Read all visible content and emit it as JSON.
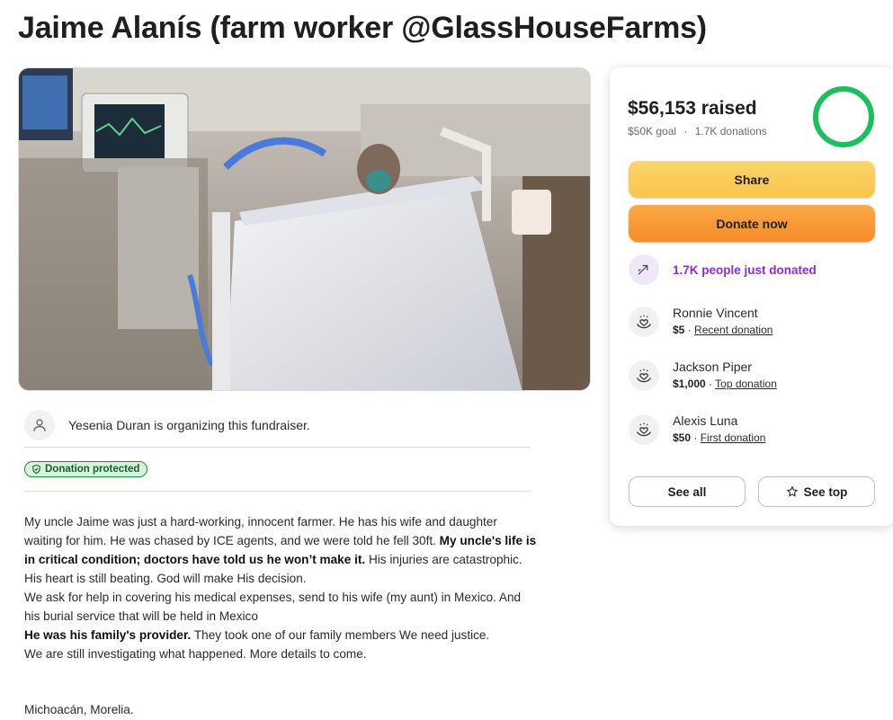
{
  "page": {
    "title": "Jaime Alanís (farm worker @GlassHouseFarms)"
  },
  "organizer": {
    "text": "Yesenia Duran is organizing this fundraiser."
  },
  "badge": {
    "label": "Donation protected"
  },
  "story": {
    "p1_a": "My uncle Jaime was just a hard-working, innocent farmer. He has his wife and daughter waiting for him. He was chased by ICE agents, and we were told he fell 30ft. ",
    "p1_bold": "My uncle's life is in critical condition; doctors have told us he won’t make it.",
    "p1_b": " His injuries are catastrophic. His heart is still beating. God will make His decision.",
    "p2": "We ask for help in covering his medical expenses, send to his wife (my aunt) in Mexico. And his burial service that will be held in Mexico",
    "p3_bold": "He was his family's provider.",
    "p3": " They took one of our family members We need justice.",
    "p4": "We are still investigating what happened. More details to come.",
    "location": "Michoacán, Morelia."
  },
  "card": {
    "amount": "$56,153",
    "raised_label": "raised",
    "goal": "$50K goal",
    "separator": "·",
    "donations": "1.7K donations",
    "progress_fraction": 1.0,
    "share_label": "Share",
    "donate_label": "Donate now",
    "just_donated": "1.7K people just donated",
    "donors": [
      {
        "name": "Ronnie Vincent",
        "amount": "$5",
        "tag": "Recent donation"
      },
      {
        "name": "Jackson Piper",
        "amount": "$1,000",
        "tag": "Top donation"
      },
      {
        "name": "Alexis Luna",
        "amount": "$50",
        "tag": "First donation"
      }
    ],
    "see_all_label": "See all",
    "see_top_label": "See top"
  },
  "colors": {
    "accent_green": "#1bbf5b",
    "share_yellow": "#f8c54a",
    "donate_orange": "#f78c26",
    "purple": "#8f2ad6"
  }
}
